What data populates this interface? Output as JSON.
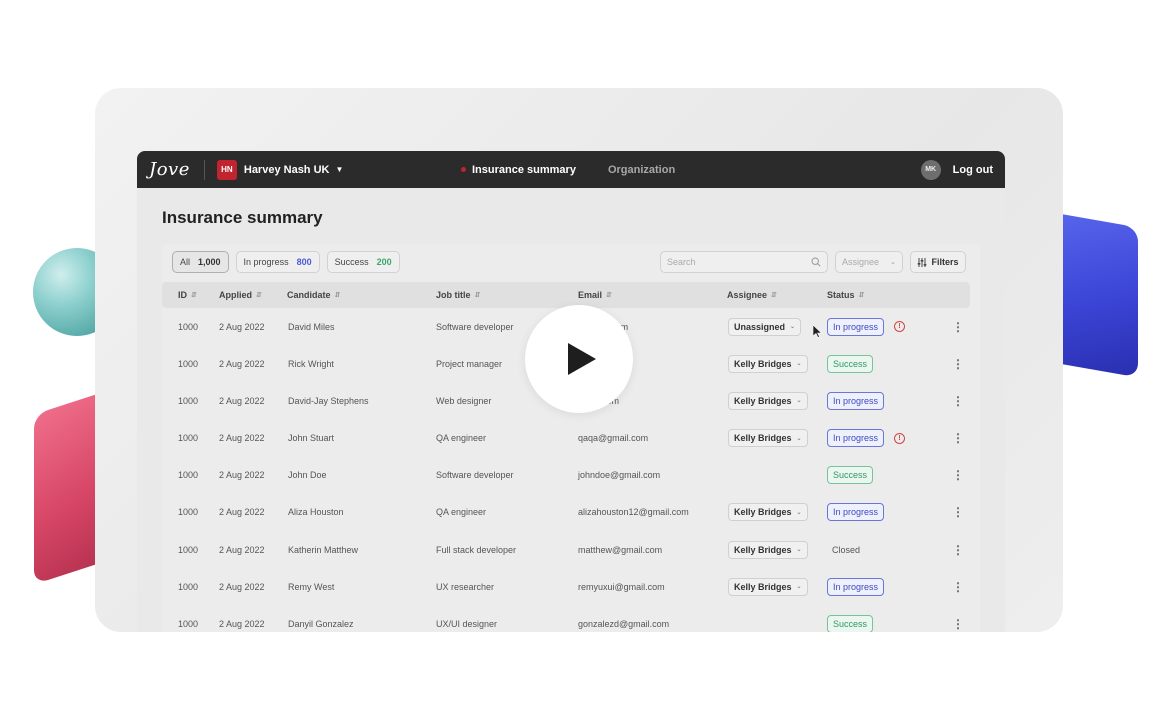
{
  "brand": {
    "logo": "Jove"
  },
  "org": {
    "badge": "HN",
    "name": "Harvey Nash UK"
  },
  "nav": {
    "active": "Insurance summary",
    "inactive": "Organization"
  },
  "user": {
    "initials": "MK",
    "logout": "Log out"
  },
  "page": {
    "title": "Insurance summary"
  },
  "filters": {
    "all": {
      "label": "All",
      "count": "1,000"
    },
    "in_progress": {
      "label": "In progress",
      "count": "800"
    },
    "success": {
      "label": "Success",
      "count": "200"
    }
  },
  "search": {
    "placeholder": "Search"
  },
  "assignee_select": {
    "placeholder": "Assignee"
  },
  "filters_button": {
    "label": "Filters"
  },
  "columns": [
    "ID",
    "Applied",
    "Candidate",
    "Job title",
    "Email",
    "Assignee",
    "Status"
  ],
  "rows": [
    {
      "id": "1000",
      "applied": "2 Aug 2022",
      "candidate": "David Miles",
      "job": "Software developer",
      "email": "@gmail.com",
      "assignee": "Unassigned",
      "status": "In progress",
      "status_type": "progress",
      "warn": true
    },
    {
      "id": "1000",
      "applied": "2 Aug 2022",
      "candidate": "Rick Wright",
      "job": "Project manager",
      "email": ".com",
      "assignee": "Kelly Bridges",
      "status": "Success",
      "status_type": "success",
      "warn": false
    },
    {
      "id": "1000",
      "applied": "2 Aug 2022",
      "candidate": "David-Jay Stephens",
      "job": "Web designer",
      "email": "gmail.com",
      "assignee": "Kelly Bridges",
      "status": "In progress",
      "status_type": "progress",
      "warn": false
    },
    {
      "id": "1000",
      "applied": "2 Aug 2022",
      "candidate": "John Stuart",
      "job": "QA engineer",
      "email": "qaqa@gmail.com",
      "assignee": "Kelly Bridges",
      "status": "In progress",
      "status_type": "progress",
      "warn": true
    },
    {
      "id": "1000",
      "applied": "2 Aug 2022",
      "candidate": "John Doe",
      "job": "Software developer",
      "email": "johndoe@gmail.com",
      "assignee": "",
      "status": "Success",
      "status_type": "success",
      "warn": false
    },
    {
      "id": "1000",
      "applied": "2 Aug 2022",
      "candidate": "Aliza Houston",
      "job": "QA engineer",
      "email": "alizahouston12@gmail.com",
      "assignee": "Kelly Bridges",
      "status": "In progress",
      "status_type": "progress",
      "warn": false
    },
    {
      "id": "1000",
      "applied": "2 Aug 2022",
      "candidate": "Katherin Matthew",
      "job": "Full stack developer",
      "email": "matthew@gmail.com",
      "assignee": "Kelly Bridges",
      "status": "Closed",
      "status_type": "closed",
      "warn": false
    },
    {
      "id": "1000",
      "applied": "2 Aug 2022",
      "candidate": "Remy West",
      "job": "UX researcher",
      "email": "remyuxui@gmail.com",
      "assignee": "Kelly Bridges",
      "status": "In progress",
      "status_type": "progress",
      "warn": false
    },
    {
      "id": "1000",
      "applied": "2 Aug 2022",
      "candidate": "Danyil Gonzalez",
      "job": "UX/UI designer",
      "email": "gonzalezd@gmail.com",
      "assignee": "",
      "status": "Success",
      "status_type": "success",
      "warn": false
    }
  ],
  "colors": {
    "brand_red": "#c0252f",
    "progress": "#3e4bc2",
    "success": "#2f9a5f",
    "topbar": "#2b2b2b"
  }
}
